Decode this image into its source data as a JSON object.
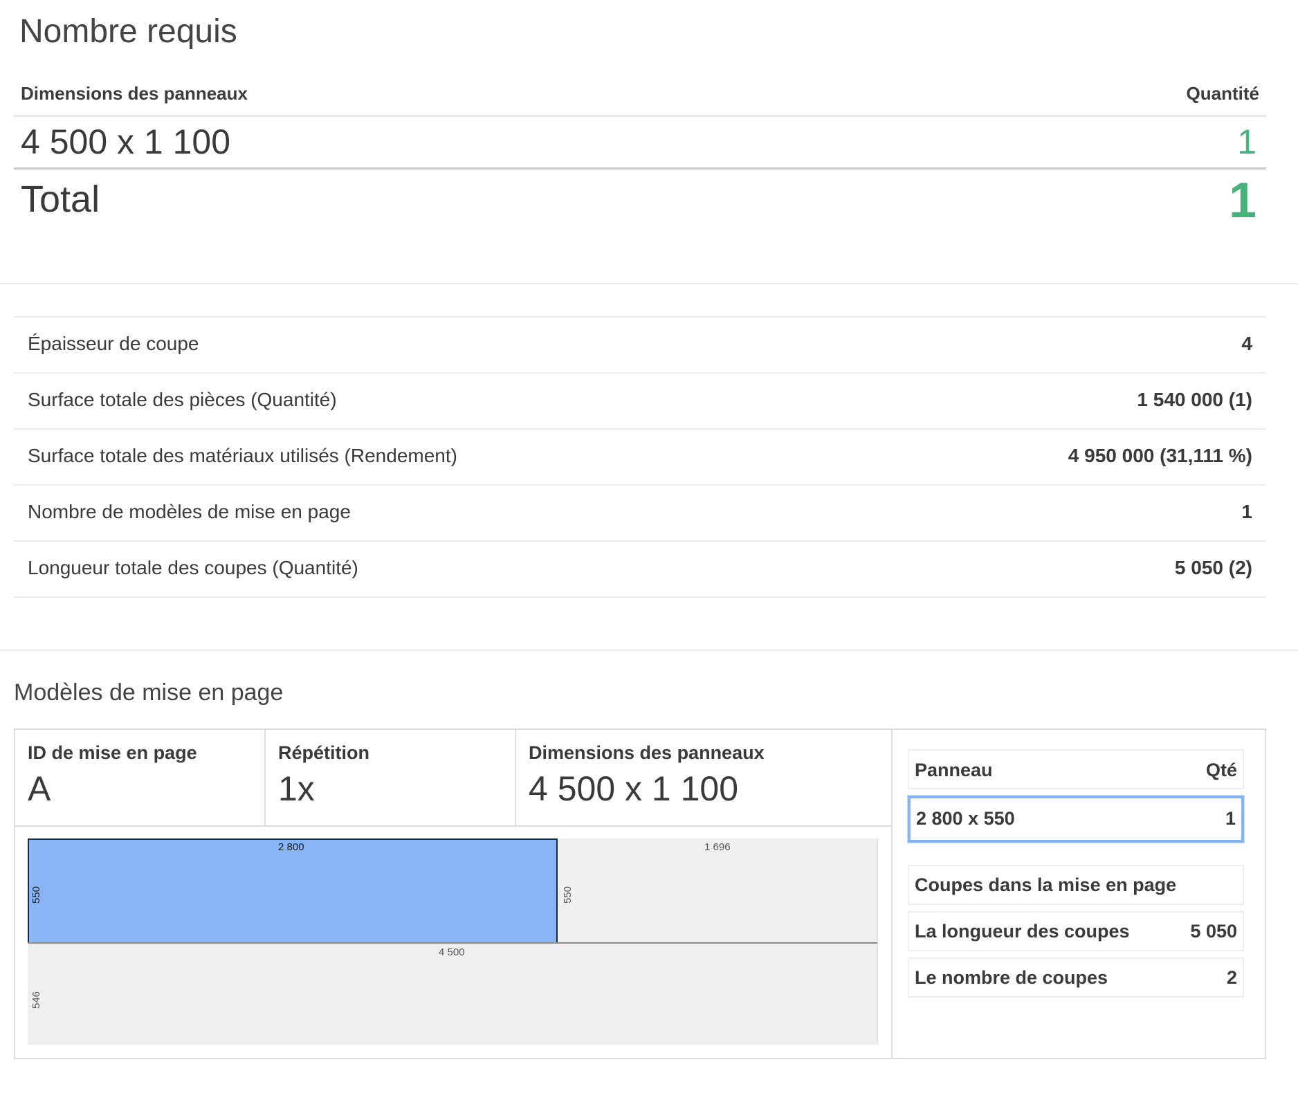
{
  "required": {
    "title": "Nombre requis",
    "col_dimensions": "Dimensions des panneaux",
    "col_quantity": "Quantité",
    "row": {
      "dimensions": "4 500 x 1 100",
      "quantity": "1"
    },
    "total_label": "Total",
    "total_value": "1"
  },
  "stats": [
    {
      "label": "Épaisseur de coupe",
      "value": "4"
    },
    {
      "label": "Surface totale des pièces (Quantité)",
      "value": "1 540 000 (1)"
    },
    {
      "label": "Surface totale des matériaux utilisés (Rendement)",
      "value": "4 950 000 (31,111 %)"
    },
    {
      "label": "Nombre de modèles de mise en page",
      "value": "1"
    },
    {
      "label": "Longueur totale des coupes (Quantité)",
      "value": "5 050 (2)"
    }
  ],
  "layouts": {
    "title": "Modèles de mise en page",
    "id_label": "ID de mise en page",
    "id_value": "A",
    "repeat_label": "Répétition",
    "repeat_value": "1x",
    "dims_label": "Dimensions des panneaux",
    "dims_value": "4 500 x 1 100",
    "diagram": {
      "piece_width_label": "2 800",
      "piece_height_label": "550",
      "offcut_width_label": "1 696",
      "offcut_height_label": "550",
      "panel_width_label": "4 500",
      "bottom_height_label": "546",
      "accent_color": "#88b5f8"
    },
    "side": {
      "panel_header": "Panneau",
      "qty_header": "Qté",
      "panel_row": {
        "size": "2 800 x 550",
        "qty": "1"
      },
      "cuts_title": "Coupes dans la mise en page",
      "cut_length_label": "La longueur des coupes",
      "cut_length_value": "5 050",
      "cut_count_label": "Le nombre de coupes",
      "cut_count_value": "2"
    }
  },
  "colors": {
    "green": "#47b37a",
    "selected_border": "#86b3f3"
  }
}
